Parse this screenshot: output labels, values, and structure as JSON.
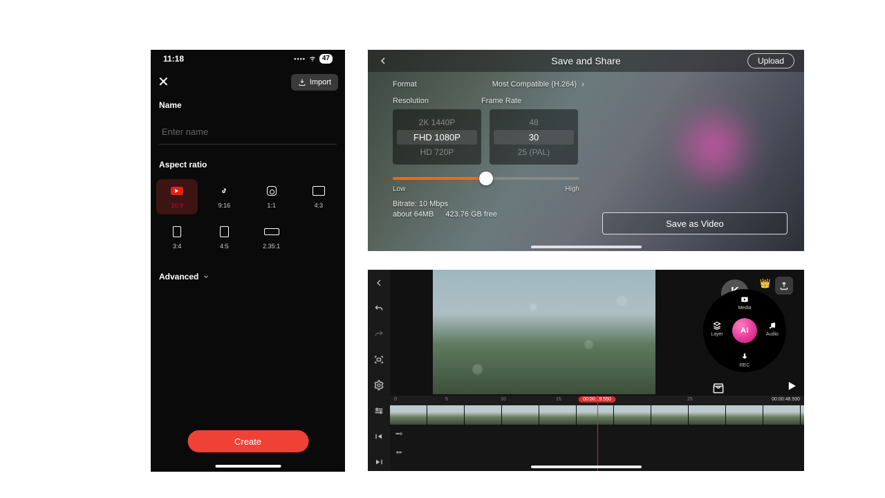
{
  "panelA": {
    "status": {
      "time": "11:18",
      "battery": "47"
    },
    "import_label": "Import",
    "name_section": "Name",
    "name_placeholder": "Enter name",
    "aspect_section": "Aspect ratio",
    "aspects": [
      {
        "label": "16:9",
        "icon": "youtube",
        "selected": true
      },
      {
        "label": "9:16",
        "icon": "tiktok",
        "selected": false
      },
      {
        "label": "1:1",
        "icon": "instagram",
        "selected": false
      },
      {
        "label": "4:3",
        "icon": "rect-4-3",
        "selected": false
      },
      {
        "label": "3:4",
        "icon": "rect-3-4",
        "selected": false
      },
      {
        "label": "4:5",
        "icon": "rect-4-5",
        "selected": false
      },
      {
        "label": "2.35:1",
        "icon": "rect-235",
        "selected": false
      }
    ],
    "advanced_label": "Advanced",
    "create_label": "Create"
  },
  "panelB": {
    "title": "Save and Share",
    "upload_label": "Upload",
    "format": {
      "label": "Format",
      "value": "Most Compatible (H.264)"
    },
    "resolution": {
      "label": "Resolution",
      "options": [
        "2K 1440P",
        "FHD 1080P",
        "HD 720P"
      ],
      "selected": "FHD 1080P"
    },
    "frame_rate": {
      "label": "Frame Rate",
      "options": [
        "48",
        "30",
        "25 (PAL)"
      ],
      "selected": "30"
    },
    "quality": {
      "low": "Low",
      "high": "High",
      "value_pct": 50
    },
    "bitrate": "Bitrate: 10 Mbps",
    "approx_size": "about 64MB",
    "free_space": "423.76 GB free",
    "save_button": "Save as Video"
  },
  "panelC": {
    "watermark": "KINEMASTER",
    "wheel": {
      "center": "AI",
      "top": {
        "label": "Media"
      },
      "left": {
        "label": "Layer"
      },
      "right": {
        "label": "Audio"
      },
      "bottom": {
        "label": "REC"
      }
    },
    "timecode_current": "00:00:19.550",
    "timecode_total": "00:00:48.930",
    "ruler_ticks": [
      "0",
      "5",
      "10",
      "15",
      "25"
    ]
  }
}
